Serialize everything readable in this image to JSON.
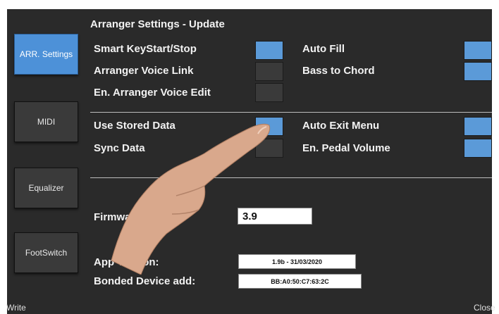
{
  "title": "Arranger Settings - Update",
  "sidebar": {
    "items": [
      {
        "label": "ARR. Settings",
        "active": true
      },
      {
        "label": "MIDI",
        "active": false
      },
      {
        "label": "Equalizer",
        "active": false
      },
      {
        "label": "FootSwitch",
        "active": false
      }
    ]
  },
  "settings": {
    "smart_keystart": {
      "label": "Smart KeyStart/Stop",
      "on": true
    },
    "arranger_voice_link": {
      "label": "Arranger Voice Link",
      "on": false
    },
    "en_arranger_voice_edit": {
      "label": "En. Arranger Voice  Edit",
      "on": false
    },
    "auto_fill": {
      "label": "Auto Fill",
      "on": true
    },
    "bass_to_chord": {
      "label": "Bass to Chord",
      "on": true
    },
    "use_stored_data": {
      "label": "Use Stored Data",
      "on": true
    },
    "sync_data": {
      "label": "Sync Data",
      "on": false
    },
    "auto_exit_menu": {
      "label": "Auto Exit Menu",
      "on": true
    },
    "en_pedal_volume": {
      "label": "En. Pedal Volume",
      "on": true
    }
  },
  "info": {
    "firmware_label": "Firmware Version:",
    "firmware_value": "3.9",
    "app_version_label": "App Version:",
    "app_version_value": "1.9b - 31/03/2020",
    "bonded_label": "Bonded Device add:",
    "bonded_value": "BB:A0:50:C7:63:2C"
  },
  "footer": {
    "write_label": "Write",
    "close_label": "Close"
  },
  "colors": {
    "toggle_on": "#5b9ad8",
    "toggle_off": "#3a3a3a",
    "active_tab": "#4d91d8",
    "panel_bg": "#2a2a2a"
  },
  "overlay": {
    "hand": "pointing-hand-photo"
  }
}
